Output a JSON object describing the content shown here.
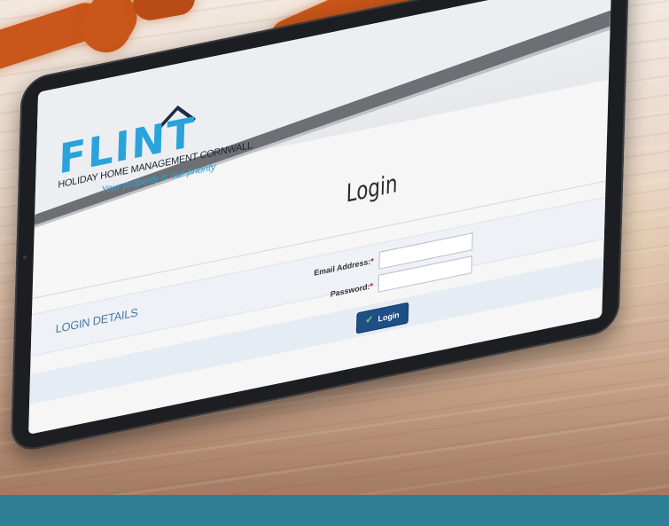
{
  "logo": {
    "wordmark": "FLINT",
    "tagline": "HOLIDAY HOME MANAGEMENT CORNWALL",
    "slogan": "Your property is our priority"
  },
  "page": {
    "title": "Login"
  },
  "login_form": {
    "section_title": "LOGIN DETAILS",
    "email_label": "Email Address:",
    "password_label": "Password:",
    "required_marker": "*",
    "email_value": "",
    "password_value": "",
    "submit_label": "Login",
    "submit_icon": "check-icon"
  },
  "colors": {
    "brand_blue": "#2aa3db",
    "button_navy": "#1e4f86",
    "required_red": "#d0021b",
    "footer_teal": "#2f7f96",
    "tablet_bezel": "#1d1e22"
  }
}
